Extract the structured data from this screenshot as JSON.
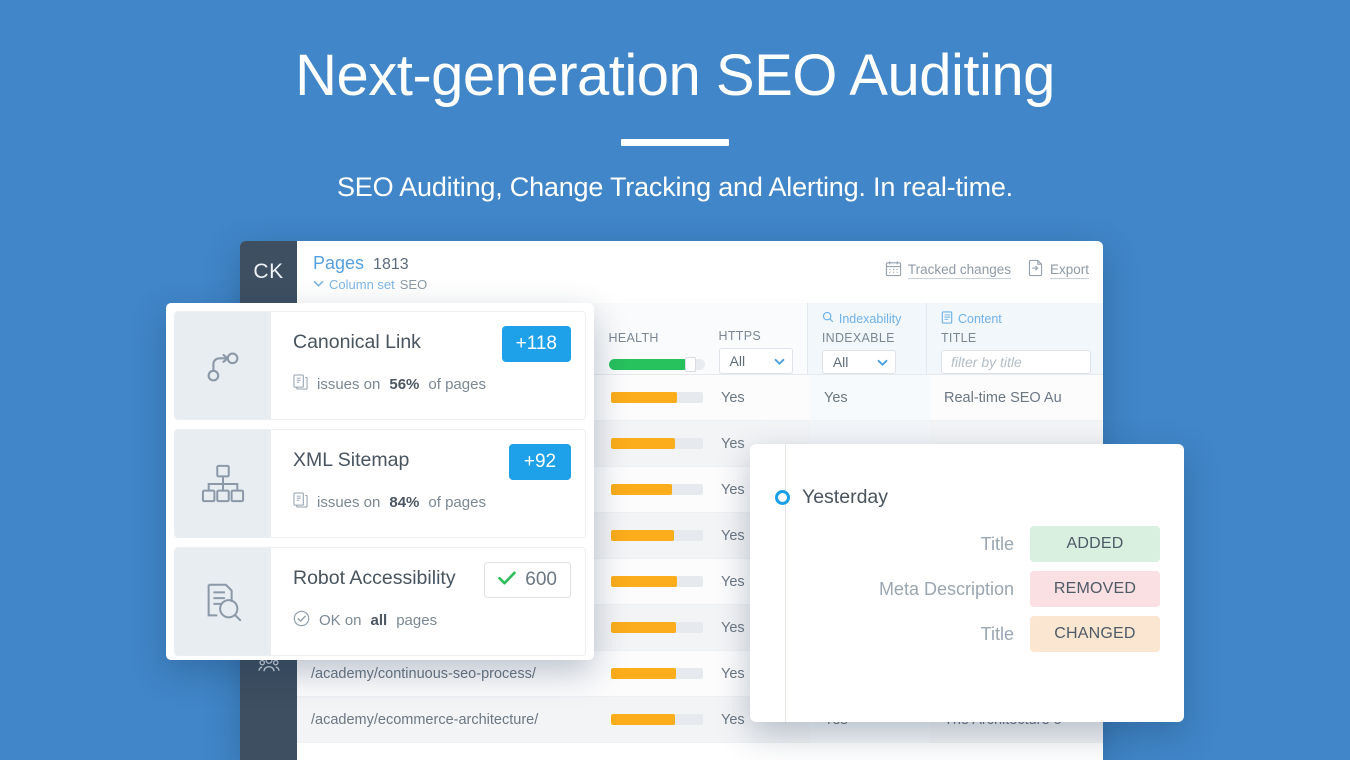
{
  "hero": {
    "title": "Next-generation SEO Auditing",
    "subtitle": "SEO Auditing, Change Tracking and Alerting. In real-time."
  },
  "app": {
    "sidebar": {
      "avatar_initials": "CK",
      "items": [
        {
          "name": "team-icon",
          "label": "Team"
        }
      ]
    },
    "header": {
      "title": "Pages",
      "count": "1813",
      "column_set_label": "Column set",
      "column_set_value": "SEO",
      "chevron": "⌄",
      "actions": [
        {
          "icon": "calendar-icon",
          "label": "Tracked changes"
        },
        {
          "icon": "export-icon",
          "label": "Export"
        }
      ]
    },
    "columns": {
      "url_label": "",
      "health_label": "HEALTH",
      "https_label": "HTTPS",
      "https_filter_value": "All",
      "indexability_group": "Indexability",
      "indexable_label": "INDEXABLE",
      "indexable_filter_value": "All",
      "content_group": "Content",
      "title_label": "TITLE",
      "title_filter_placeholder": "filter by title"
    },
    "rows": [
      {
        "url": "",
        "health": 72,
        "https": "Yes",
        "indexable": "Yes",
        "title": "Real-time SEO Au"
      },
      {
        "url": "",
        "health": 70,
        "https": "Yes",
        "indexable": "",
        "title": ""
      },
      {
        "url": "",
        "health": 66,
        "https": "Yes",
        "indexable": "",
        "title": ""
      },
      {
        "url": "",
        "health": 68,
        "https": "Yes",
        "indexable": "",
        "title": ""
      },
      {
        "url": "",
        "health": 72,
        "https": "Yes",
        "indexable": "",
        "title": ""
      },
      {
        "url": "",
        "health": 71,
        "https": "Yes",
        "indexable": "",
        "title": ""
      },
      {
        "url": "/academy/continuous-seo-process/",
        "health": 71,
        "https": "Yes",
        "indexable": "",
        "title": ""
      },
      {
        "url": "/academy/ecommerce-architecture/",
        "health": 70,
        "https": "Yes",
        "indexable": "Yes",
        "title": "The Architecture o"
      }
    ]
  },
  "audit_cards": [
    {
      "icon": "canonical-link-icon",
      "title": "Canonical Link",
      "badge": "+118",
      "badge_type": "blue",
      "sub_icon": "pages-icon",
      "sub_prefix": "issues on ",
      "sub_strong": "56%",
      "sub_suffix": " of pages"
    },
    {
      "icon": "sitemap-icon",
      "title": "XML Sitemap",
      "badge": "+92",
      "badge_type": "blue",
      "sub_icon": "pages-icon",
      "sub_prefix": "issues on ",
      "sub_strong": "84%",
      "sub_suffix": " of pages"
    },
    {
      "icon": "robot-accessibility-icon",
      "title": "Robot Accessibility",
      "badge": "600",
      "badge_type": "ok",
      "sub_icon": "check-circle-icon",
      "sub_prefix": "OK on ",
      "sub_strong": "all",
      "sub_suffix": " pages"
    }
  ],
  "changes": {
    "heading": "Yesterday",
    "entries": [
      {
        "label": "Title",
        "status": "ADDED",
        "status_type": "added"
      },
      {
        "label": "Meta Description",
        "status": "REMOVED",
        "status_type": "removed"
      },
      {
        "label": "Title",
        "status": "CHANGED",
        "status_type": "changed"
      }
    ]
  },
  "colors": {
    "background": "#4086c8",
    "accent_blue": "#1ea1e8",
    "health_bar": "#fbad1b",
    "health_good": "#27c15e",
    "added": "#d9f0e0",
    "removed": "#fadfe3",
    "changed": "#fbe6d2",
    "sidebar": "#3d4f61"
  }
}
